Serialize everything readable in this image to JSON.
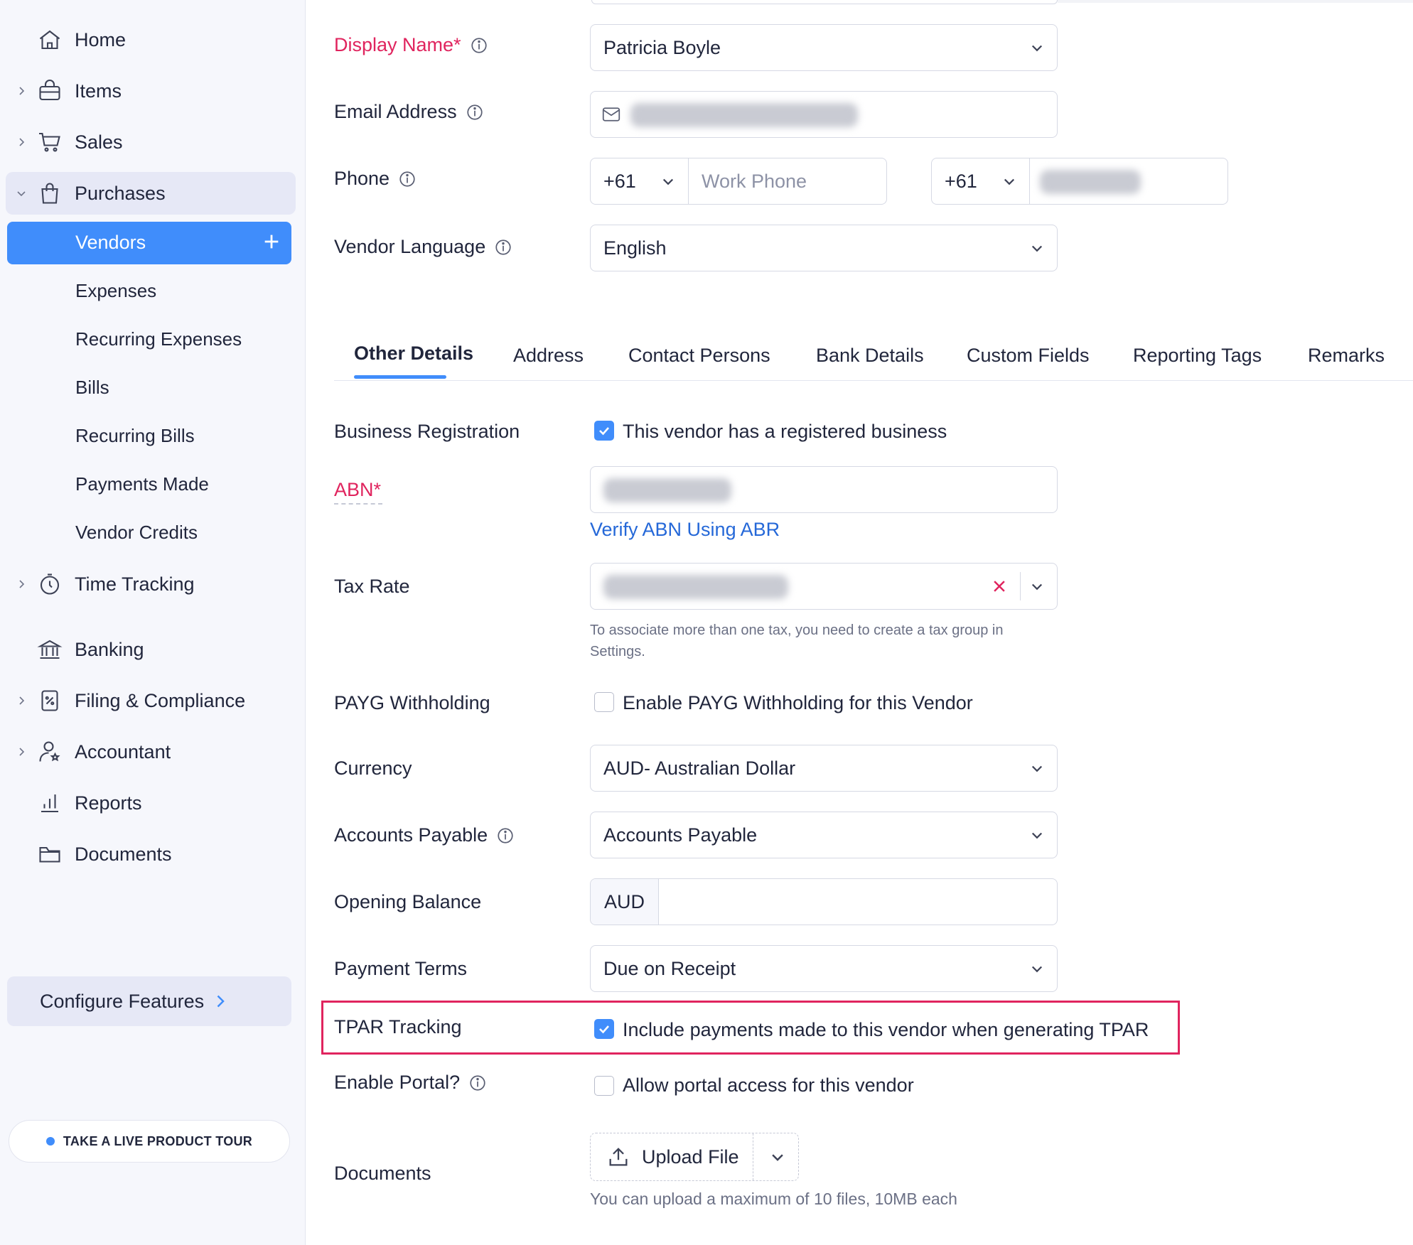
{
  "sidebar": {
    "home": "Home",
    "items": "Items",
    "sales": "Sales",
    "purchases": "Purchases",
    "vendors": "Vendors",
    "expenses": "Expenses",
    "recurring_expenses": "Recurring Expenses",
    "bills": "Bills",
    "recurring_bills": "Recurring Bills",
    "payments_made": "Payments Made",
    "vendor_credits": "Vendor Credits",
    "time_tracking": "Time Tracking",
    "banking": "Banking",
    "filing": "Filing & Compliance",
    "accountant": "Accountant",
    "reports": "Reports",
    "documents": "Documents",
    "configure": "Configure Features",
    "tour": "TAKE A LIVE PRODUCT TOUR"
  },
  "form": {
    "display_name_label": "Display Name*",
    "display_name_value": "Patricia Boyle",
    "email_label": "Email Address",
    "phone_label": "Phone",
    "work_code": "+61",
    "work_placeholder": "Work Phone",
    "mobile_code": "+61",
    "language_label": "Vendor Language",
    "language_value": "English"
  },
  "tabs": [
    "Other Details",
    "Address",
    "Contact Persons",
    "Bank Details",
    "Custom Fields",
    "Reporting Tags",
    "Remarks"
  ],
  "details": {
    "business_reg_label": "Business Registration",
    "business_reg_check": "This vendor has a registered business",
    "abn_label": "ABN*",
    "verify_link": "Verify ABN Using ABR",
    "tax_rate_label": "Tax Rate",
    "tax_hint_1": "To associate more than one tax, you need to create a tax group in",
    "tax_hint_2": "Settings.",
    "payg_label": "PAYG Withholding",
    "payg_check": "Enable PAYG Withholding for this Vendor",
    "currency_label": "Currency",
    "currency_value": "AUD- Australian Dollar",
    "ap_label": "Accounts Payable",
    "ap_value": "Accounts Payable",
    "opening_label": "Opening Balance",
    "opening_prefix": "AUD",
    "terms_label": "Payment Terms",
    "terms_value": "Due on Receipt",
    "tpar_label": "TPAR Tracking",
    "tpar_check": "Include payments made to this vendor when generating TPAR",
    "portal_label": "Enable Portal?",
    "portal_check": "Allow portal access for this vendor",
    "documents_label": "Documents",
    "upload_label": "Upload File",
    "upload_hint": "You can upload a maximum of 10 files, 10MB each"
  },
  "colors": {
    "accent": "#408dfb",
    "required": "#e0245e",
    "link": "#2568d8"
  }
}
